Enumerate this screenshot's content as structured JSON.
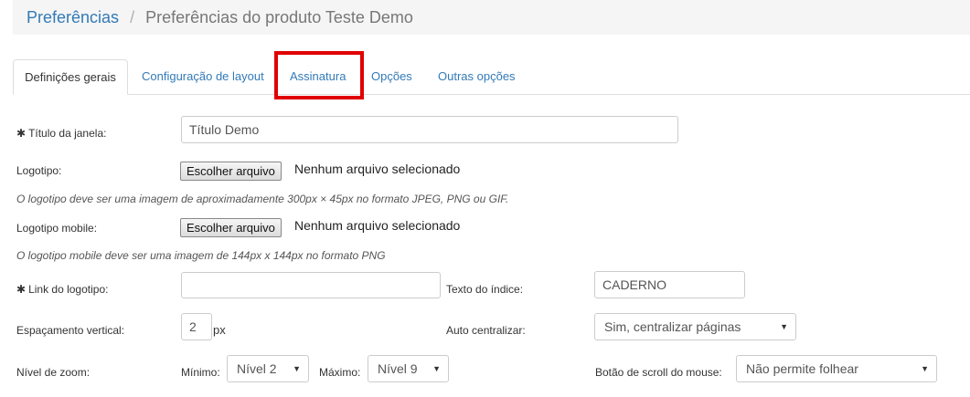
{
  "breadcrumb": {
    "root": "Preferências",
    "separator": "/",
    "current": "Preferências do produto Teste Demo"
  },
  "tabs": [
    {
      "label": "Definições gerais",
      "active": true
    },
    {
      "label": "Configuração de layout",
      "active": false
    },
    {
      "label": "Assinatura",
      "active": false,
      "highlighted": true
    },
    {
      "label": "Opções",
      "active": false
    },
    {
      "label": "Outras opções",
      "active": false
    }
  ],
  "highlight_color": "#e00000",
  "form": {
    "required_marker": "✱",
    "window_title": {
      "label": "Título da janela:",
      "value": "Título Demo"
    },
    "logo": {
      "label": "Logotipo:",
      "button": "Escolher arquivo",
      "status": "Nenhum arquivo selecionado",
      "help": "O logotipo deve ser uma imagem de aproximadamente 300px × 45px no formato JPEG, PNG ou GIF."
    },
    "logo_mobile": {
      "label": "Logotipo mobile:",
      "button": "Escolher arquivo",
      "status": "Nenhum arquivo selecionado",
      "help": "O logotipo mobile deve ser uma imagem de 144px x 144px no formato PNG"
    },
    "logo_link": {
      "label": "Link do logotipo:",
      "value": ""
    },
    "index_text": {
      "label": "Texto do índice:",
      "value": "CADERNO"
    },
    "vertical_spacing": {
      "label": "Espaçamento vertical:",
      "value": "2",
      "unit": "px"
    },
    "auto_center": {
      "label": "Auto centralizar:",
      "selected": "Sim, centralizar páginas"
    },
    "zoom": {
      "label": "Nível de zoom:",
      "min_label": "Mínimo:",
      "min_value": "Nível 2",
      "max_label": "Máximo:",
      "max_value": "Nível 9"
    },
    "scroll_button": {
      "label": "Botão de scroll do mouse:",
      "selected": "Não permite folhear"
    }
  }
}
